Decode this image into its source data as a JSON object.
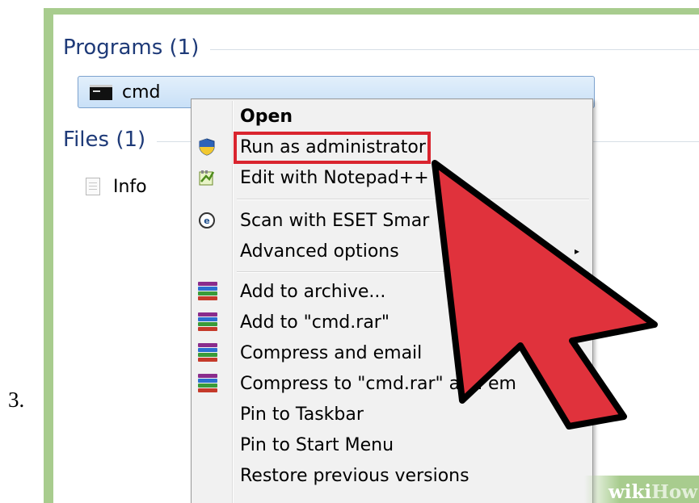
{
  "step_number": "3.",
  "sections": {
    "programs": {
      "header": "Programs (1)",
      "items": [
        {
          "label": "cmd",
          "icon": "cmd-icon"
        }
      ]
    },
    "files": {
      "header": "Files (1)",
      "items": [
        {
          "label": "Info",
          "icon": "document-icon"
        }
      ]
    }
  },
  "context_menu": {
    "items": [
      {
        "id": "open",
        "label": "Open",
        "bold": true
      },
      {
        "id": "run_as_admin",
        "label": "Run as administrator",
        "icon": "uac-shield-icon",
        "highlighted": true
      },
      {
        "id": "edit_notepadpp",
        "label": "Edit with Notepad++",
        "icon": "notepad-plus-plus-icon"
      },
      {
        "id": "scan_eset",
        "label": "Scan with ESET Smar",
        "icon": "eset-icon"
      },
      {
        "id": "advanced_options",
        "label": "Advanced options",
        "submenu": true
      },
      {
        "id": "add_archive",
        "label": "Add to archive...",
        "icon": "winrar-icon"
      },
      {
        "id": "add_cmd_rar",
        "label": "Add to \"cmd.rar\"",
        "icon": "winrar-icon"
      },
      {
        "id": "compress_email",
        "label": "Compress and email",
        "icon": "winrar-icon"
      },
      {
        "id": "compress_cmd_rar",
        "label": "Compress to \"cmd.rar\" and em",
        "icon": "winrar-icon"
      },
      {
        "id": "pin_taskbar",
        "label": "Pin to Taskbar"
      },
      {
        "id": "pin_start",
        "label": "Pin to Start Menu"
      },
      {
        "id": "restore_versions",
        "label": "Restore previous versions"
      }
    ],
    "submenu_arrow": "▸"
  },
  "colors": {
    "frame": "#a8cc8e",
    "section_header": "#1e3a78",
    "highlight": "#d9242e",
    "arrow_fill": "#e0323c"
  },
  "watermark": {
    "part1": "wiki",
    "part2": "How"
  }
}
